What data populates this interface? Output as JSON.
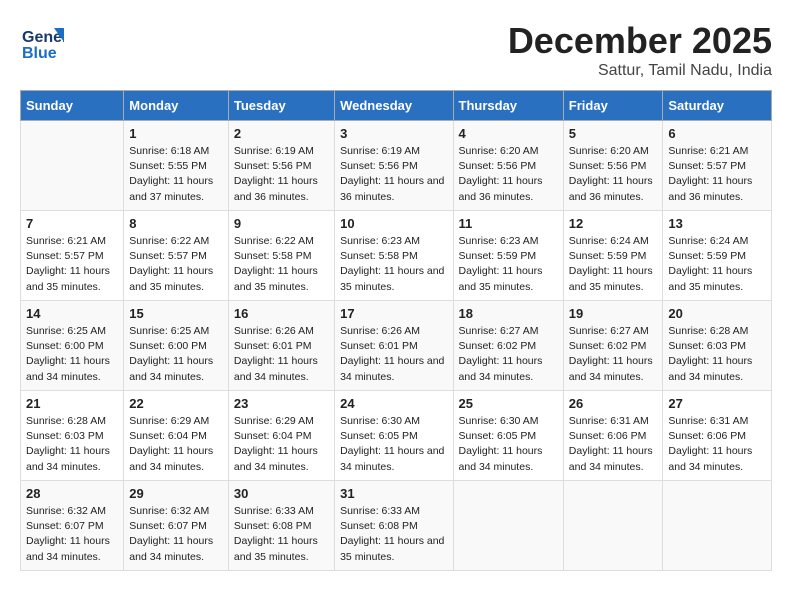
{
  "header": {
    "logo_general": "General",
    "logo_blue": "Blue",
    "month": "December 2025",
    "location": "Sattur, Tamil Nadu, India"
  },
  "weekdays": [
    "Sunday",
    "Monday",
    "Tuesday",
    "Wednesday",
    "Thursday",
    "Friday",
    "Saturday"
  ],
  "weeks": [
    [
      {
        "day": "",
        "sunrise": "",
        "sunset": "",
        "daylight": ""
      },
      {
        "day": "1",
        "sunrise": "6:18 AM",
        "sunset": "5:55 PM",
        "daylight": "11 hours and 37 minutes."
      },
      {
        "day": "2",
        "sunrise": "6:19 AM",
        "sunset": "5:56 PM",
        "daylight": "11 hours and 36 minutes."
      },
      {
        "day": "3",
        "sunrise": "6:19 AM",
        "sunset": "5:56 PM",
        "daylight": "11 hours and 36 minutes."
      },
      {
        "day": "4",
        "sunrise": "6:20 AM",
        "sunset": "5:56 PM",
        "daylight": "11 hours and 36 minutes."
      },
      {
        "day": "5",
        "sunrise": "6:20 AM",
        "sunset": "5:56 PM",
        "daylight": "11 hours and 36 minutes."
      },
      {
        "day": "6",
        "sunrise": "6:21 AM",
        "sunset": "5:57 PM",
        "daylight": "11 hours and 36 minutes."
      }
    ],
    [
      {
        "day": "7",
        "sunrise": "6:21 AM",
        "sunset": "5:57 PM",
        "daylight": "11 hours and 35 minutes."
      },
      {
        "day": "8",
        "sunrise": "6:22 AM",
        "sunset": "5:57 PM",
        "daylight": "11 hours and 35 minutes."
      },
      {
        "day": "9",
        "sunrise": "6:22 AM",
        "sunset": "5:58 PM",
        "daylight": "11 hours and 35 minutes."
      },
      {
        "day": "10",
        "sunrise": "6:23 AM",
        "sunset": "5:58 PM",
        "daylight": "11 hours and 35 minutes."
      },
      {
        "day": "11",
        "sunrise": "6:23 AM",
        "sunset": "5:59 PM",
        "daylight": "11 hours and 35 minutes."
      },
      {
        "day": "12",
        "sunrise": "6:24 AM",
        "sunset": "5:59 PM",
        "daylight": "11 hours and 35 minutes."
      },
      {
        "day": "13",
        "sunrise": "6:24 AM",
        "sunset": "5:59 PM",
        "daylight": "11 hours and 35 minutes."
      }
    ],
    [
      {
        "day": "14",
        "sunrise": "6:25 AM",
        "sunset": "6:00 PM",
        "daylight": "11 hours and 34 minutes."
      },
      {
        "day": "15",
        "sunrise": "6:25 AM",
        "sunset": "6:00 PM",
        "daylight": "11 hours and 34 minutes."
      },
      {
        "day": "16",
        "sunrise": "6:26 AM",
        "sunset": "6:01 PM",
        "daylight": "11 hours and 34 minutes."
      },
      {
        "day": "17",
        "sunrise": "6:26 AM",
        "sunset": "6:01 PM",
        "daylight": "11 hours and 34 minutes."
      },
      {
        "day": "18",
        "sunrise": "6:27 AM",
        "sunset": "6:02 PM",
        "daylight": "11 hours and 34 minutes."
      },
      {
        "day": "19",
        "sunrise": "6:27 AM",
        "sunset": "6:02 PM",
        "daylight": "11 hours and 34 minutes."
      },
      {
        "day": "20",
        "sunrise": "6:28 AM",
        "sunset": "6:03 PM",
        "daylight": "11 hours and 34 minutes."
      }
    ],
    [
      {
        "day": "21",
        "sunrise": "6:28 AM",
        "sunset": "6:03 PM",
        "daylight": "11 hours and 34 minutes."
      },
      {
        "day": "22",
        "sunrise": "6:29 AM",
        "sunset": "6:04 PM",
        "daylight": "11 hours and 34 minutes."
      },
      {
        "day": "23",
        "sunrise": "6:29 AM",
        "sunset": "6:04 PM",
        "daylight": "11 hours and 34 minutes."
      },
      {
        "day": "24",
        "sunrise": "6:30 AM",
        "sunset": "6:05 PM",
        "daylight": "11 hours and 34 minutes."
      },
      {
        "day": "25",
        "sunrise": "6:30 AM",
        "sunset": "6:05 PM",
        "daylight": "11 hours and 34 minutes."
      },
      {
        "day": "26",
        "sunrise": "6:31 AM",
        "sunset": "6:06 PM",
        "daylight": "11 hours and 34 minutes."
      },
      {
        "day": "27",
        "sunrise": "6:31 AM",
        "sunset": "6:06 PM",
        "daylight": "11 hours and 34 minutes."
      }
    ],
    [
      {
        "day": "28",
        "sunrise": "6:32 AM",
        "sunset": "6:07 PM",
        "daylight": "11 hours and 34 minutes."
      },
      {
        "day": "29",
        "sunrise": "6:32 AM",
        "sunset": "6:07 PM",
        "daylight": "11 hours and 34 minutes."
      },
      {
        "day": "30",
        "sunrise": "6:33 AM",
        "sunset": "6:08 PM",
        "daylight": "11 hours and 35 minutes."
      },
      {
        "day": "31",
        "sunrise": "6:33 AM",
        "sunset": "6:08 PM",
        "daylight": "11 hours and 35 minutes."
      },
      {
        "day": "",
        "sunrise": "",
        "sunset": "",
        "daylight": ""
      },
      {
        "day": "",
        "sunrise": "",
        "sunset": "",
        "daylight": ""
      },
      {
        "day": "",
        "sunrise": "",
        "sunset": "",
        "daylight": ""
      }
    ]
  ]
}
